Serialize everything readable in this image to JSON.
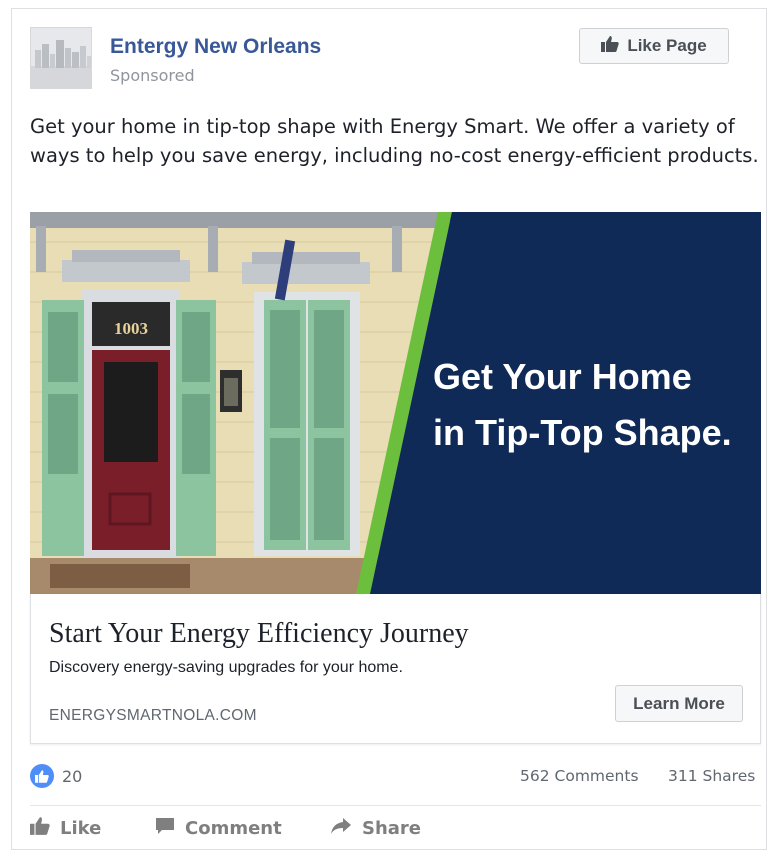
{
  "post": {
    "page_name": "Entergy New Orleans",
    "sponsored_label": "Sponsored",
    "like_page_label": "Like Page",
    "text": "Get your home in tip-top shape with Energy Smart. We offer a variety of ways to help you save energy, including no-cost energy-efficient products."
  },
  "ad_image": {
    "door_number": "1003",
    "headline_line1": "Get Your Home",
    "headline_line2": "in Tip-Top Shape."
  },
  "link": {
    "title": "Start Your Energy Efficiency Journey",
    "description": "Discovery energy-saving upgrades for your home.",
    "domain": "ENERGYSMARTNOLA.COM",
    "cta_label": "Learn More"
  },
  "stats": {
    "likes": "20",
    "comments": "562 Comments",
    "shares": "311 Shares"
  },
  "actions": {
    "like": "Like",
    "comment": "Comment",
    "share": "Share"
  },
  "colors": {
    "link_blue": "#385898",
    "banner_navy": "#0f2a57",
    "accent_green": "#6cbf3c",
    "shutter_green": "#8cc4a0",
    "door_red": "#7a1f2a",
    "like_blue": "#4f8ef7"
  },
  "icons": [
    "thumbs-up-icon",
    "comment-icon",
    "share-icon",
    "like-reaction-icon"
  ]
}
